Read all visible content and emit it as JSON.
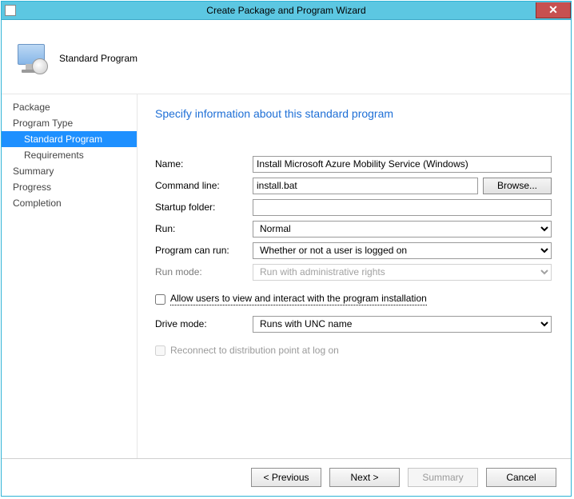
{
  "window": {
    "title": "Create Package and Program Wizard"
  },
  "header": {
    "title": "Standard Program"
  },
  "sidebar": {
    "steps": [
      {
        "label": "Package",
        "sub": false,
        "active": false
      },
      {
        "label": "Program Type",
        "sub": false,
        "active": false
      },
      {
        "label": "Standard Program",
        "sub": true,
        "active": true
      },
      {
        "label": "Requirements",
        "sub": true,
        "active": false
      },
      {
        "label": "Summary",
        "sub": false,
        "active": false
      },
      {
        "label": "Progress",
        "sub": false,
        "active": false
      },
      {
        "label": "Completion",
        "sub": false,
        "active": false
      }
    ]
  },
  "content": {
    "heading": "Specify information about this standard program",
    "labels": {
      "name": "Name:",
      "command_line": "Command line:",
      "startup_folder": "Startup folder:",
      "run": "Run:",
      "program_can_run": "Program can run:",
      "run_mode": "Run mode:",
      "allow_interact": "Allow users to view and interact with the program installation",
      "drive_mode": "Drive mode:",
      "reconnect": "Reconnect to distribution point at log on",
      "browse": "Browse..."
    },
    "values": {
      "name": "Install Microsoft Azure Mobility Service (Windows)",
      "command_line": "install.bat",
      "startup_folder": "",
      "run": "Normal",
      "program_can_run": "Whether or not a user is logged on",
      "run_mode": "Run with administrative rights",
      "allow_interact_checked": false,
      "drive_mode": "Runs with UNC name",
      "reconnect_checked": false
    }
  },
  "footer": {
    "previous": "< Previous",
    "next": "Next >",
    "summary": "Summary",
    "cancel": "Cancel"
  }
}
